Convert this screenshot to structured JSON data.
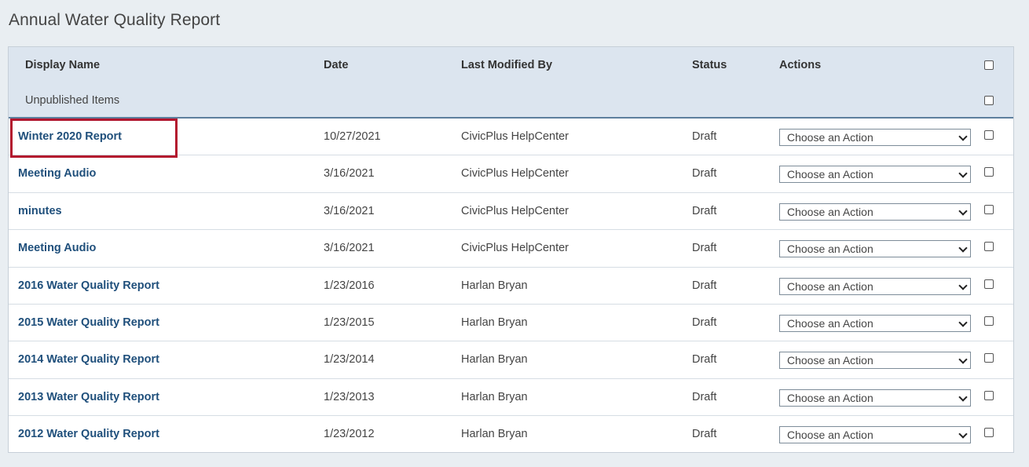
{
  "page": {
    "title": "Annual Water Quality Report"
  },
  "table": {
    "headers": {
      "display_name": "Display Name",
      "date": "Date",
      "last_modified_by": "Last Modified By",
      "status": "Status",
      "actions": "Actions"
    },
    "group_label": "Unpublished Items",
    "action_placeholder": "Choose an Action",
    "rows": [
      {
        "name": "Winter 2020 Report",
        "date": "10/27/2021",
        "modified_by": "CivicPlus HelpCenter",
        "status": "Draft"
      },
      {
        "name": "Meeting Audio",
        "date": "3/16/2021",
        "modified_by": "CivicPlus HelpCenter",
        "status": "Draft"
      },
      {
        "name": "minutes",
        "date": "3/16/2021",
        "modified_by": "CivicPlus HelpCenter",
        "status": "Draft"
      },
      {
        "name": "Meeting Audio",
        "date": "3/16/2021",
        "modified_by": "CivicPlus HelpCenter",
        "status": "Draft"
      },
      {
        "name": "2016 Water Quality Report",
        "date": "1/23/2016",
        "modified_by": "Harlan Bryan",
        "status": "Draft"
      },
      {
        "name": "2015 Water Quality Report",
        "date": "1/23/2015",
        "modified_by": "Harlan Bryan",
        "status": "Draft"
      },
      {
        "name": "2014 Water Quality Report",
        "date": "1/23/2014",
        "modified_by": "Harlan Bryan",
        "status": "Draft"
      },
      {
        "name": "2013 Water Quality Report",
        "date": "1/23/2013",
        "modified_by": "Harlan Bryan",
        "status": "Draft"
      },
      {
        "name": "2012 Water Quality Report",
        "date": "1/23/2012",
        "modified_by": "Harlan Bryan",
        "status": "Draft"
      }
    ]
  },
  "colors": {
    "link": "#1f4f7b",
    "header_bg": "#dce5ef",
    "highlight": "#b3162e"
  }
}
